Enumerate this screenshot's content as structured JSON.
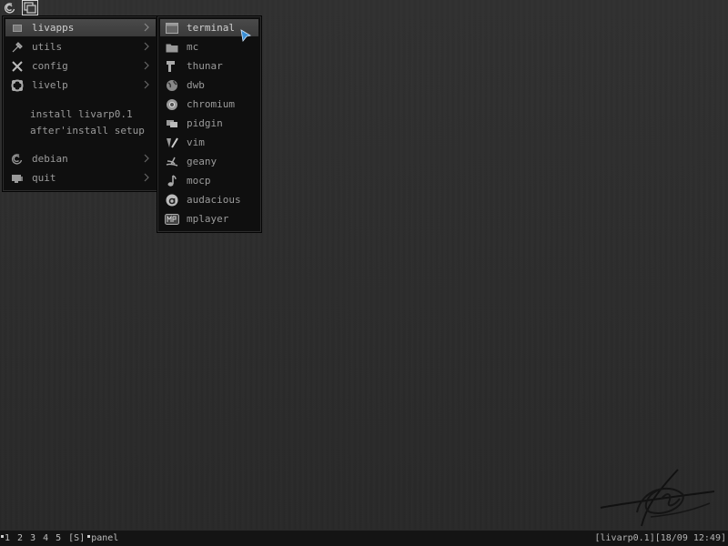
{
  "launcher": {
    "icons": [
      "debian-swirl-icon",
      "window-stack-icon"
    ]
  },
  "main_menu": {
    "items": [
      {
        "label": "livapps",
        "icon": "folder-icon",
        "submenu": true,
        "highlighted": true
      },
      {
        "label": "utils",
        "icon": "tools-icon",
        "submenu": true
      },
      {
        "label": "config",
        "icon": "wrench-screwdriver-icon",
        "submenu": true
      },
      {
        "label": "livelp",
        "icon": "lifebuoy-icon",
        "submenu": true
      },
      {
        "label": "install livarp0.1",
        "icon": "",
        "submenu": false
      },
      {
        "label": "after'install setup",
        "icon": "",
        "submenu": false
      },
      {
        "label": "debian",
        "icon": "debian-swirl-icon",
        "submenu": true
      },
      {
        "label": "quit",
        "icon": "monitor-icon",
        "submenu": true
      }
    ]
  },
  "submenu": {
    "items": [
      {
        "label": "terminal",
        "icon": "terminal-icon",
        "highlighted": true
      },
      {
        "label": "mc",
        "icon": "folder-icon"
      },
      {
        "label": "thunar",
        "icon": "file-manager-icon"
      },
      {
        "label": "dwb",
        "icon": "globe-icon"
      },
      {
        "label": "chromium",
        "icon": "chromium-icon"
      },
      {
        "label": "pidgin",
        "icon": "chat-icon"
      },
      {
        "label": "vim",
        "icon": "vim-icon"
      },
      {
        "label": "geany",
        "icon": "geany-icon"
      },
      {
        "label": "mocp",
        "icon": "music-note-icon"
      },
      {
        "label": "audacious",
        "icon": "audacious-icon"
      },
      {
        "label": "mplayer",
        "icon": "mplayer-icon"
      }
    ]
  },
  "taskbar": {
    "workspaces": [
      "1",
      "2",
      "3",
      "4",
      "5"
    ],
    "layout": "[S]",
    "panel_label": "panel",
    "status": "[livarp0.1][18/09 12:49]"
  },
  "colors": {
    "desktop": "#2d2d2d",
    "menu_bg": "#0f0f0f",
    "highlight": "#444444",
    "text": "#9b9b9b",
    "cursor": "#3a8fd6"
  }
}
